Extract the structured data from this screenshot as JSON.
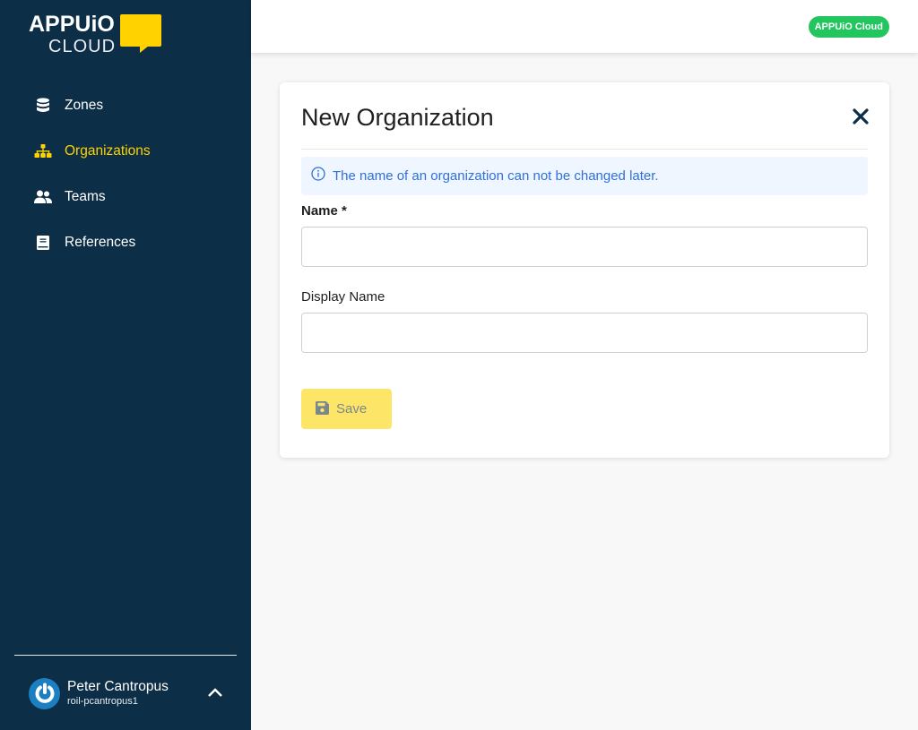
{
  "brand": {
    "logo_top": "APPUiO",
    "logo_bottom": "CLOUD",
    "accent_color": "#ffd200",
    "sidebar_color": "#0c2e47"
  },
  "sidebar": {
    "items": [
      {
        "label": "Zones",
        "icon": "database-icon",
        "active": false
      },
      {
        "label": "Organizations",
        "icon": "sitemap-icon",
        "active": true
      },
      {
        "label": "Teams",
        "icon": "users-icon",
        "active": false
      },
      {
        "label": "References",
        "icon": "book-icon",
        "active": false
      }
    ],
    "user": {
      "name": "Peter Cantropus",
      "login": "roil-pcantropus1",
      "toggle_icon": "chevron-up-icon"
    }
  },
  "topbar": {
    "badge": "APPUiO Cloud",
    "badge_color": "#22c55e"
  },
  "dialog": {
    "title": "New Organization",
    "close_icon": "close-icon",
    "alert": "The name of an organization can not be changed later.",
    "fields": [
      {
        "label": "Name *",
        "value": "",
        "placeholder": ""
      },
      {
        "label": "Display Name",
        "value": "",
        "placeholder": ""
      }
    ],
    "save_label": "Save",
    "save_icon": "save-icon"
  }
}
